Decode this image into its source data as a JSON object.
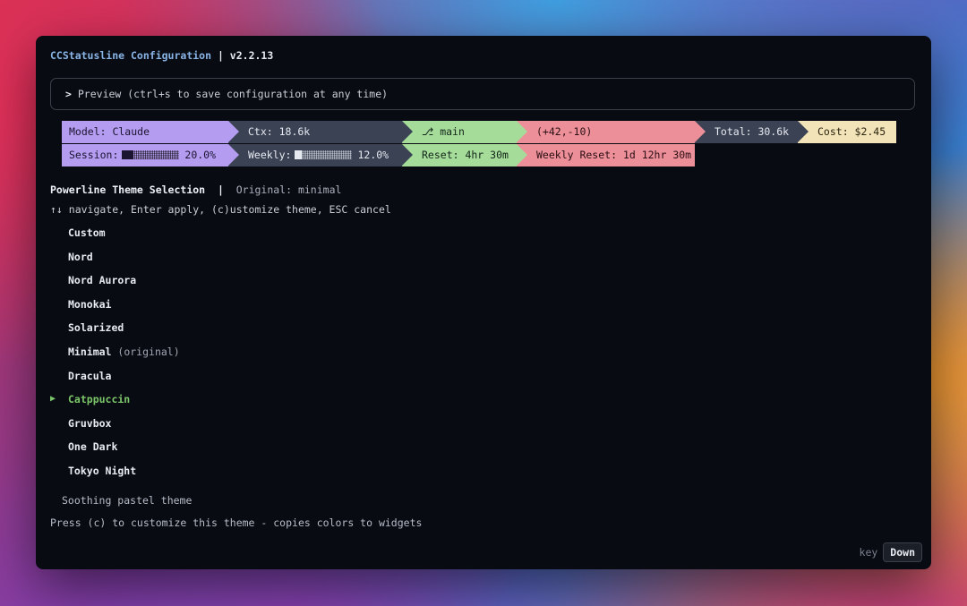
{
  "header": {
    "app_name": "CCStatusline Configuration",
    "separator": " | ",
    "version": "v2.2.13"
  },
  "preview": {
    "caret": ">",
    "label": "Preview (ctrl+s to save configuration at any time)"
  },
  "statusline": {
    "row1": {
      "model": "Model: Claude",
      "ctx": "Ctx: 18.6k",
      "branch_icon": "git-branch-icon",
      "branch_glyph": "⎇",
      "branch": "main",
      "diff": "(+42,-10)",
      "total": "Total: 30.6k",
      "cost": "Cost: $2.45"
    },
    "row2": {
      "session_label": "Session:",
      "session_value": "20.0%",
      "session_fraction": 0.2,
      "weekly_label": "Weekly:",
      "weekly_value": "12.0%",
      "weekly_fraction": 0.12,
      "reset": "Reset: 4hr 30m",
      "weekly_reset": "Weekly Reset: 1d 12hr 30m"
    },
    "colors": {
      "purple": "#b49cf0",
      "slate": "#3b4254",
      "green": "#a5dc9a",
      "pink": "#ec8f98",
      "cream": "#f2e3b8"
    }
  },
  "theme_selection": {
    "title": "Powerline Theme Selection",
    "separator": "  |  ",
    "original": "Original: minimal",
    "hint": "↑↓ navigate, Enter apply, (c)ustomize theme, ESC cancel",
    "pointer_glyph": "▶",
    "selected_index": 7,
    "themes": [
      {
        "label": "Custom",
        "note": ""
      },
      {
        "label": "Nord",
        "note": ""
      },
      {
        "label": "Nord Aurora",
        "note": ""
      },
      {
        "label": "Monokai",
        "note": ""
      },
      {
        "label": "Solarized",
        "note": ""
      },
      {
        "label": "Minimal",
        "note": "(original)"
      },
      {
        "label": "Dracula",
        "note": ""
      },
      {
        "label": "Catppuccin",
        "note": ""
      },
      {
        "label": "Gruvbox",
        "note": ""
      },
      {
        "label": "One Dark",
        "note": ""
      },
      {
        "label": "Tokyo Night",
        "note": ""
      }
    ],
    "description": "Soothing pastel theme",
    "customize_hint": "Press (c) to customize this theme - copies colors to widgets"
  },
  "key_overlay": {
    "label": "key",
    "key": "Down"
  }
}
